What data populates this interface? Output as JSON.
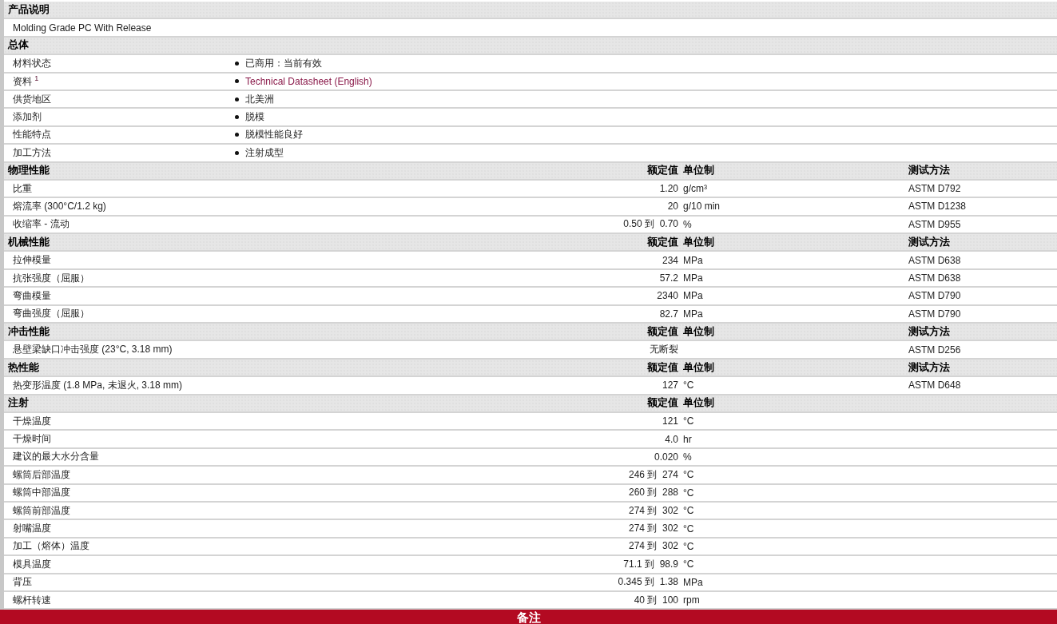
{
  "sections": [
    {
      "title": "产品说明",
      "kind": "text",
      "rows": [
        {
          "text": "Molding Grade PC With Release"
        }
      ]
    },
    {
      "title": "总体",
      "kind": "list",
      "rows": [
        {
          "label": "材料状态",
          "value": "已商用：当前有效",
          "kind": "plain"
        },
        {
          "label": "资料 $^{1}$",
          "value": "Technical Datasheet (English)",
          "kind": "link"
        },
        {
          "label": "供货地区",
          "value": "北美洲",
          "kind": "plain"
        },
        {
          "label": "添加剂",
          "value": "脱模",
          "kind": "plain"
        },
        {
          "label": "性能特点",
          "value": "脱模性能良好",
          "kind": "plain"
        },
        {
          "label": "加工方法",
          "value": "注射成型",
          "kind": "plain"
        }
      ]
    },
    {
      "title": "物理性能",
      "kind": "props",
      "columns": [
        "额定值",
        "单位制",
        "测试方法"
      ],
      "rows": [
        {
          "label": "比重",
          "value": "1.20",
          "unit": "g/cm³",
          "method": "ASTM D792"
        },
        {
          "label": "熔流率  (300°C/1.2 kg)",
          "value": "20",
          "unit": "g/10 min",
          "method": "ASTM D1238"
        },
        {
          "label": "收缩率  - 流动",
          "value": "0.50 到  0.70",
          "unit": "%",
          "method": "ASTM D955"
        }
      ]
    },
    {
      "title": "机械性能",
      "kind": "props",
      "columns": [
        "额定值",
        "单位制",
        "测试方法"
      ],
      "rows": [
        {
          "label": "拉伸模量",
          "value": "234",
          "unit": "MPa",
          "method": "ASTM D638"
        },
        {
          "label": "抗张强度（屈服）",
          "value": "57.2",
          "unit": "MPa",
          "method": "ASTM D638"
        },
        {
          "label": "弯曲模量",
          "value": "2340",
          "unit": "MPa",
          "method": "ASTM D790"
        },
        {
          "label": "弯曲强度（屈服）",
          "value": "82.7",
          "unit": "MPa",
          "method": "ASTM D790"
        }
      ]
    },
    {
      "title": "冲击性能",
      "kind": "props",
      "columns": [
        "额定值",
        "单位制",
        "测试方法"
      ],
      "rows": [
        {
          "label": "悬壁梁缺口冲击强度  (23°C, 3.18 mm)",
          "value": "无断裂",
          "method": "ASTM D256"
        }
      ]
    },
    {
      "title": "热性能",
      "kind": "props",
      "columns": [
        "额定值",
        "单位制",
        "测试方法"
      ],
      "rows": [
        {
          "label": "热变形温度  (1.8 MPa, 未退火, 3.18 mm)",
          "value": "127",
          "unit": "°C",
          "method": "ASTM D648"
        }
      ]
    },
    {
      "title": "注射",
      "kind": "props",
      "columns": [
        "额定值",
        "单位制"
      ],
      "rows": [
        {
          "label": "干燥温度",
          "value": "121",
          "unit": "°C"
        },
        {
          "label": "干燥时间",
          "value": "4.0",
          "unit": "hr"
        },
        {
          "label": "建议的最大水分含量",
          "value": "0.020",
          "unit": "%"
        },
        {
          "label": "螺筒后部温度",
          "value": "246 到  274",
          "unit": "°C"
        },
        {
          "label": "螺筒中部温度",
          "value": "260 到  288",
          "unit": "°C"
        },
        {
          "label": "螺筒前部温度",
          "value": "274 到  302",
          "unit": "°C"
        },
        {
          "label": "射嘴温度",
          "value": "274 到  302",
          "unit": "°C"
        },
        {
          "label": "加工（熔体）温度",
          "value": "274 到  302",
          "unit": "°C"
        },
        {
          "label": "模具温度",
          "value": "71.1 到  98.9",
          "unit": "°C"
        },
        {
          "label": "背压",
          "value": "0.345 到  1.38",
          "unit": "MPa"
        },
        {
          "label": "螺杆转速",
          "value": "40 到  100",
          "unit": "rpm"
        }
      ]
    }
  ],
  "footer": {
    "title": "备注"
  }
}
